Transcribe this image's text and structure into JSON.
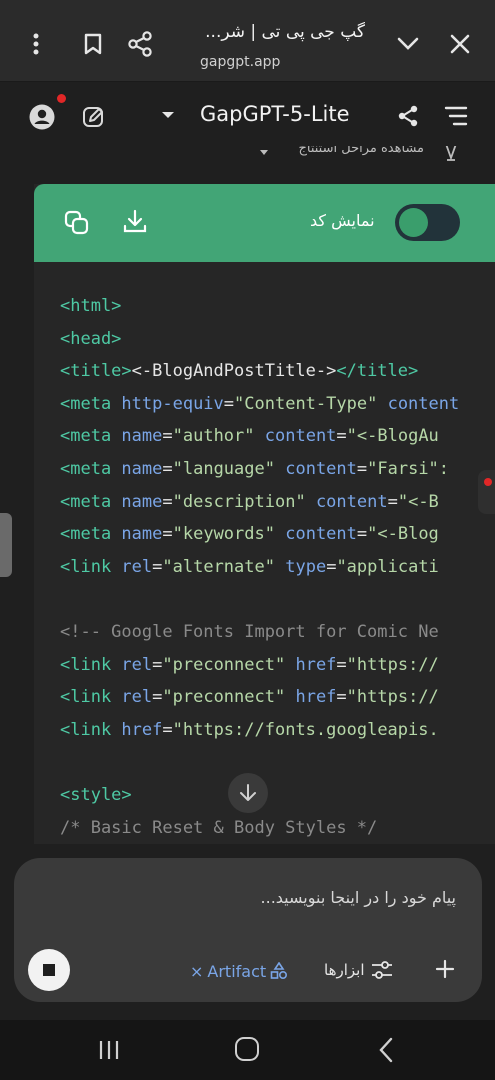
{
  "browser": {
    "title": "گپ جی پی تی | شر...",
    "url": "gapgpt.app"
  },
  "header": {
    "model_name": "GapGPT-5-Lite"
  },
  "steps": {
    "label": "مشاهده مراحل استنتاج"
  },
  "code_card": {
    "toggle_label": "نمایش کد",
    "toggle_on": true
  },
  "code_lines": [
    [
      {
        "t": "t",
        "v": "<html>"
      }
    ],
    [
      {
        "t": "t",
        "v": "<head>"
      }
    ],
    [
      {
        "t": "t",
        "v": "<title>"
      },
      {
        "t": "p",
        "v": "<-BlogAndPostTitle->"
      },
      {
        "t": "t",
        "v": "</title>"
      }
    ],
    [
      {
        "t": "t",
        "v": "<meta "
      },
      {
        "t": "a",
        "v": "http-equiv"
      },
      {
        "t": "p",
        "v": "="
      },
      {
        "t": "s",
        "v": "\"Content-Type\""
      },
      {
        "t": "p",
        "v": " "
      },
      {
        "t": "a",
        "v": "content"
      }
    ],
    [
      {
        "t": "t",
        "v": "<meta "
      },
      {
        "t": "a",
        "v": "name"
      },
      {
        "t": "p",
        "v": "="
      },
      {
        "t": "s",
        "v": "\"author\""
      },
      {
        "t": "p",
        "v": " "
      },
      {
        "t": "a",
        "v": "content"
      },
      {
        "t": "p",
        "v": "="
      },
      {
        "t": "s",
        "v": "\"<-BlogAu"
      }
    ],
    [
      {
        "t": "t",
        "v": "<meta "
      },
      {
        "t": "a",
        "v": "name"
      },
      {
        "t": "p",
        "v": "="
      },
      {
        "t": "s",
        "v": "\"language\""
      },
      {
        "t": "p",
        "v": " "
      },
      {
        "t": "a",
        "v": "content"
      },
      {
        "t": "p",
        "v": "="
      },
      {
        "t": "s",
        "v": "\"Farsi\":"
      }
    ],
    [
      {
        "t": "t",
        "v": "<meta "
      },
      {
        "t": "a",
        "v": "name"
      },
      {
        "t": "p",
        "v": "="
      },
      {
        "t": "s",
        "v": "\"description\""
      },
      {
        "t": "p",
        "v": " "
      },
      {
        "t": "a",
        "v": "content"
      },
      {
        "t": "p",
        "v": "="
      },
      {
        "t": "s",
        "v": "\"<-B"
      }
    ],
    [
      {
        "t": "t",
        "v": "<meta "
      },
      {
        "t": "a",
        "v": "name"
      },
      {
        "t": "p",
        "v": "="
      },
      {
        "t": "s",
        "v": "\"keywords\""
      },
      {
        "t": "p",
        "v": " "
      },
      {
        "t": "a",
        "v": "content"
      },
      {
        "t": "p",
        "v": "="
      },
      {
        "t": "s",
        "v": "\"<-Blog"
      }
    ],
    [
      {
        "t": "t",
        "v": "<link "
      },
      {
        "t": "a",
        "v": "rel"
      },
      {
        "t": "p",
        "v": "="
      },
      {
        "t": "s",
        "v": "\"alternate\""
      },
      {
        "t": "p",
        "v": " "
      },
      {
        "t": "a",
        "v": "type"
      },
      {
        "t": "p",
        "v": "="
      },
      {
        "t": "s",
        "v": "\"applicati"
      }
    ],
    [
      {
        "t": "p",
        "v": " "
      }
    ],
    [
      {
        "t": "c",
        "v": "<!-- Google Fonts Import for Comic Ne"
      }
    ],
    [
      {
        "t": "t",
        "v": "<link "
      },
      {
        "t": "a",
        "v": "rel"
      },
      {
        "t": "p",
        "v": "="
      },
      {
        "t": "s",
        "v": "\"preconnect\""
      },
      {
        "t": "p",
        "v": " "
      },
      {
        "t": "a",
        "v": "href"
      },
      {
        "t": "p",
        "v": "="
      },
      {
        "t": "s",
        "v": "\"https://"
      }
    ],
    [
      {
        "t": "t",
        "v": "<link "
      },
      {
        "t": "a",
        "v": "rel"
      },
      {
        "t": "p",
        "v": "="
      },
      {
        "t": "s",
        "v": "\"preconnect\""
      },
      {
        "t": "p",
        "v": " "
      },
      {
        "t": "a",
        "v": "href"
      },
      {
        "t": "p",
        "v": "="
      },
      {
        "t": "s",
        "v": "\"https://"
      }
    ],
    [
      {
        "t": "t",
        "v": "<link "
      },
      {
        "t": "a",
        "v": "href"
      },
      {
        "t": "p",
        "v": "="
      },
      {
        "t": "s",
        "v": "\"https://fonts.googleapis."
      }
    ],
    [
      {
        "t": "p",
        "v": " "
      }
    ],
    [
      {
        "t": "t",
        "v": "<style>"
      }
    ],
    [
      {
        "t": "c",
        "v": "/* Basic Reset & Body Styles */"
      }
    ]
  ],
  "composer": {
    "placeholder": "پیام خود را در اینجا بنویسید...",
    "artifact_label": "Artifact",
    "tools_label": "ابزارها"
  },
  "colors": {
    "accent_green": "#42a576",
    "code_tag": "#4ec9a4",
    "code_attr": "#7aa5e6",
    "code_string": "#b6d7a8",
    "code_comment": "#8a8a8a",
    "notification_red": "#e12727"
  }
}
